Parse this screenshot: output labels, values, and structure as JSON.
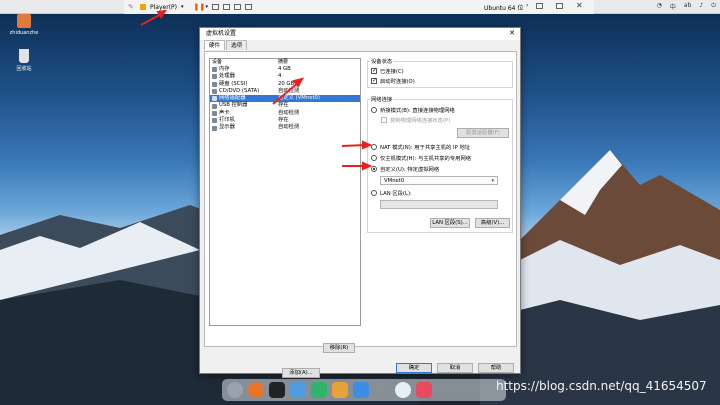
{
  "menubar": {
    "player_label": "Player(P)",
    "vm_name": "Ubuntu 64 位",
    "tray_items": [
      "中",
      "ab"
    ]
  },
  "desktop": {
    "icons": [
      {
        "label": "zhiduanzhe",
        "icon": "home-folder-icon"
      },
      {
        "label": "回收站",
        "icon": "trash-icon"
      }
    ]
  },
  "dialog": {
    "title": "虚拟机设置",
    "tabs": [
      {
        "label": "硬件",
        "active": true
      },
      {
        "label": "选项",
        "active": false
      }
    ],
    "device_list": {
      "header": {
        "device": "设备",
        "summary": "摘要"
      },
      "rows": [
        {
          "device": "内存",
          "summary": "4 GB",
          "icon": "memory-icon",
          "selected": false
        },
        {
          "device": "处理器",
          "summary": "4",
          "icon": "cpu-icon",
          "selected": false
        },
        {
          "device": "硬盘 (SCSI)",
          "summary": "20 GB",
          "icon": "disk-icon",
          "selected": false
        },
        {
          "device": "CD/DVD (SATA)",
          "summary": "自动检测",
          "icon": "cd-icon",
          "selected": false
        },
        {
          "device": "网络适配器",
          "summary": "自定义 (VMnet0)",
          "icon": "network-icon",
          "selected": true
        },
        {
          "device": "USB 控制器",
          "summary": "存在",
          "icon": "usb-icon",
          "selected": false
        },
        {
          "device": "声卡",
          "summary": "自动检测",
          "icon": "sound-icon",
          "selected": false
        },
        {
          "device": "打印机",
          "summary": "存在",
          "icon": "printer-icon",
          "selected": false
        },
        {
          "device": "显示器",
          "summary": "自动检测",
          "icon": "display-icon",
          "selected": false
        }
      ],
      "add_button": "添加(A)...",
      "remove_button": "移除(R)"
    },
    "device_status": {
      "label": "设备状态",
      "connected": {
        "label": "已连接(C)",
        "checked": true
      },
      "connect_at_power_on": {
        "label": "启动时连接(O)",
        "checked": true
      }
    },
    "network_connection": {
      "label": "网络连接",
      "bridged": {
        "label": "桥接模式(B): 直接连接物理网络",
        "selected": false
      },
      "replicate": {
        "label": "复制物理网络连接状态(P)",
        "checked": false,
        "disabled": true
      },
      "configure_adapters_button": "配置适配器(F)",
      "nat": {
        "label": "NAT 模式(N): 用于共享主机的 IP 地址",
        "selected": false
      },
      "host_only": {
        "label": "仅主机模式(H): 与主机共享的专用网络",
        "selected": false
      },
      "custom": {
        "label": "自定义(U): 特定虚拟网络",
        "selected": true
      },
      "custom_value": "VMnet0",
      "lan_segment": {
        "label": "LAN 区段(L):",
        "selected": false
      },
      "lan_segment_value": ""
    },
    "lan_segments_button": "LAN 区段(S)...",
    "advanced_button": "高级(V)...",
    "ok_button": "确定",
    "cancel_button": "取消",
    "help_button": "帮助"
  },
  "watermark": "https://blog.csdn.net/qq_41654507",
  "colors": {
    "selection": "#3377d3",
    "annotation_arrow": "#e8221a"
  }
}
